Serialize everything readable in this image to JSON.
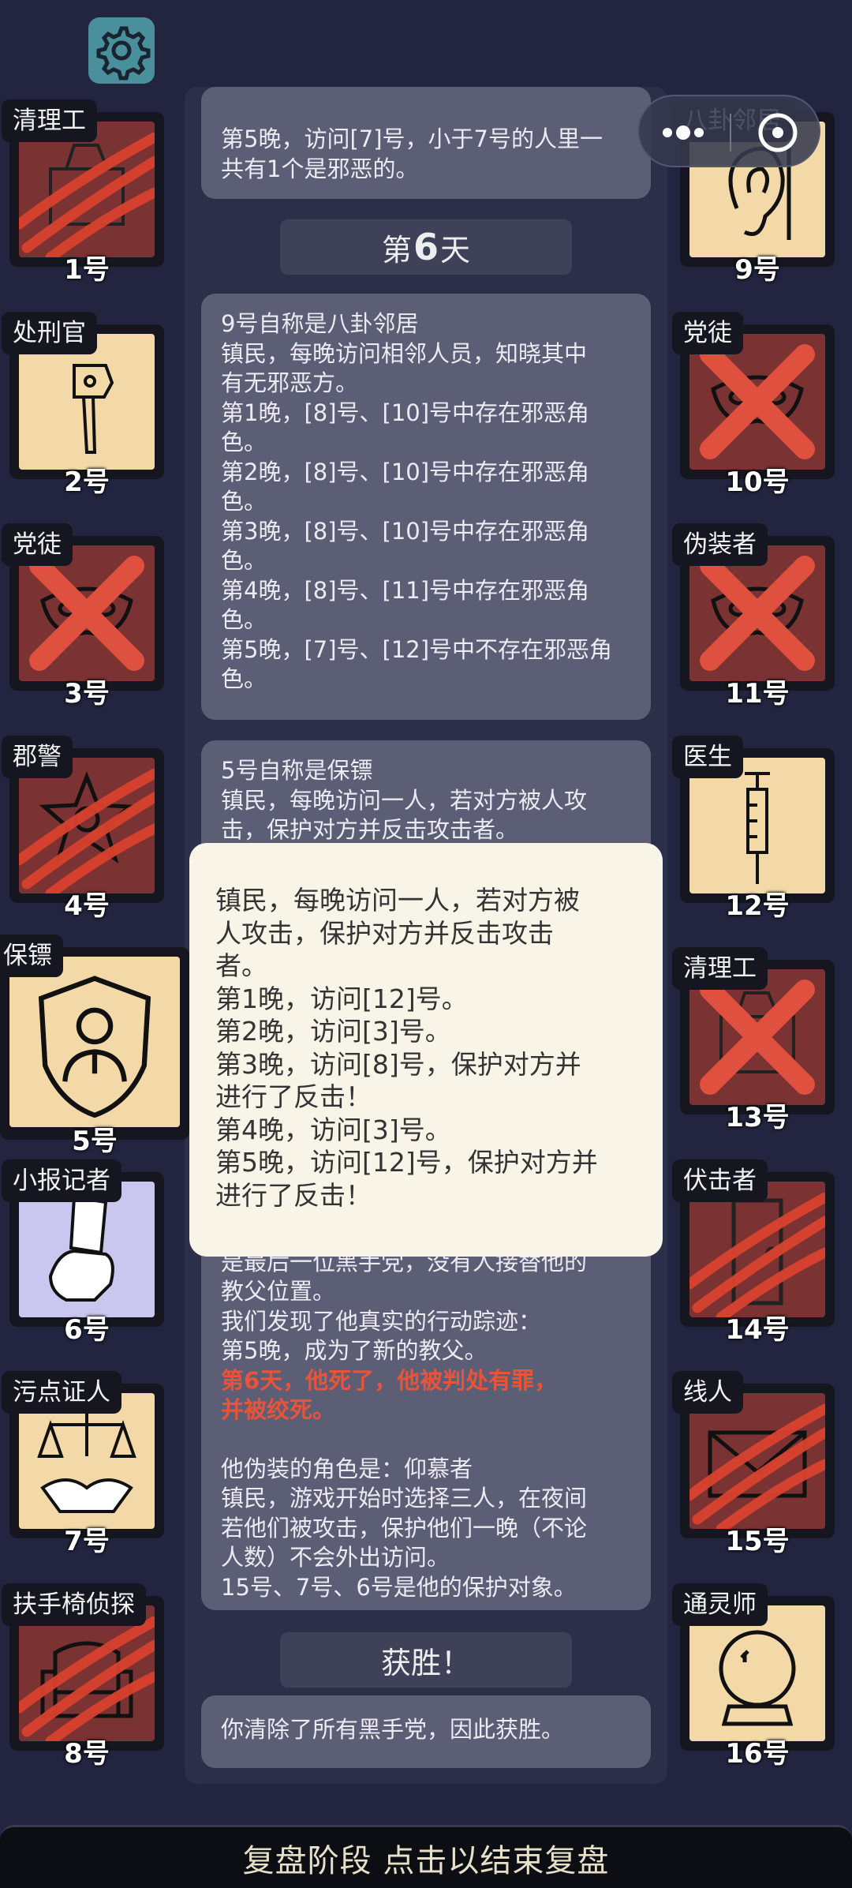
{
  "top_bar": {
    "settings_icon": "gear-icon",
    "menu_icon": "more-dots-icon",
    "record_icon": "target-icon"
  },
  "players": [
    {
      "role": "清理工",
      "num": "1号",
      "state": "dead-slashed"
    },
    {
      "role": "处刑官",
      "num": "2号",
      "state": "alive"
    },
    {
      "role": "党徒",
      "num": "3号",
      "state": "dead-crossed"
    },
    {
      "role": "郡警",
      "num": "4号",
      "state": "dead-slashed"
    },
    {
      "role": "保镖",
      "num": "5号",
      "state": "alive-selected"
    },
    {
      "role": "小报记者",
      "num": "6号",
      "state": "alive"
    },
    {
      "role": "污点证人",
      "num": "7号",
      "state": "alive"
    },
    {
      "role": "扶手椅侦探",
      "num": "8号",
      "state": "dead-slashed"
    },
    {
      "role": "八卦邻居",
      "num": "9号",
      "state": "alive"
    },
    {
      "role": "党徒",
      "num": "10号",
      "state": "dead-crossed"
    },
    {
      "role": "伪装者",
      "num": "11号",
      "state": "dead-crossed"
    },
    {
      "role": "医生",
      "num": "12号",
      "state": "alive"
    },
    {
      "role": "清理工",
      "num": "13号",
      "state": "dead-crossed"
    },
    {
      "role": "伏击者",
      "num": "14号",
      "state": "dead-slashed"
    },
    {
      "role": "线人",
      "num": "15号",
      "state": "dead-slashed"
    },
    {
      "role": "通灵师",
      "num": "16号",
      "state": "alive"
    }
  ],
  "log": {
    "card0": [
      "第5晚，访问[7]号，小于7号的人里一",
      "共有1个是邪恶的。"
    ],
    "day6": {
      "prefix": "第",
      "num": "6",
      "suffix": "天"
    },
    "card1": [
      "9号自称是八卦邻居",
      "镇民，每晚访问相邻人员，知晓其中",
      "有无邪恶方。",
      "第1晚，[8]号、[10]号中存在邪恶角",
      "色。",
      "第2晚，[8]号、[10]号中存在邪恶角",
      "色。",
      "第3晚，[8]号、[10]号中存在邪恶角",
      "色。",
      "第4晚，[8]号、[11]号中存在邪恶角",
      "色。",
      "第5晚，[7]号、[12]号中不存在邪恶角",
      "色。"
    ],
    "card2": [
      "5号自称是保镖",
      "镇民，每晚访问一人，若对方被人攻",
      "击，保护对方并反击攻击者。"
    ],
    "card3_plain": [
      "是最后一位黑手党，没有人接替他的",
      "教父位置。",
      "我们发现了他真实的行动踪迹：",
      "第5晚，成为了新的教父。"
    ],
    "card3_red": [
      "第6天，他死了，他被判处有罪，",
      "并被绞死。"
    ],
    "card3_tail": [
      "他伪装的角色是：仰慕者",
      "镇民，游戏开始时选择三人，在夜间",
      "若他们被攻击，保护他们一晚（不论",
      "人数）不会外出访问。",
      "15号、7号、6号是他的保护对象。"
    ],
    "victory_header": "获胜！",
    "victory_text": "你清除了所有黑手党，因此获胜。"
  },
  "popup": [
    "镇民，每晚访问一人，若对方被",
    "人攻击，保护对方并反击攻击",
    "者。",
    "第1晚，访问[12]号。",
    "第2晚，访问[3]号。",
    "第3晚，访问[8]号，保护对方并",
    "进行了反击！",
    "第4晚，访问[3]号。",
    "第5晚，访问[12]号，保护对方并",
    "进行了反击！"
  ],
  "bottom_button": "复盘阶段 点击以结束复盘",
  "colors": {
    "background": "#232540",
    "card": "#5c5e76",
    "tile": "#f3d9a8",
    "dead_tile": "#7a3232",
    "slash": "#d9422e",
    "highlight": "#e8543a"
  }
}
